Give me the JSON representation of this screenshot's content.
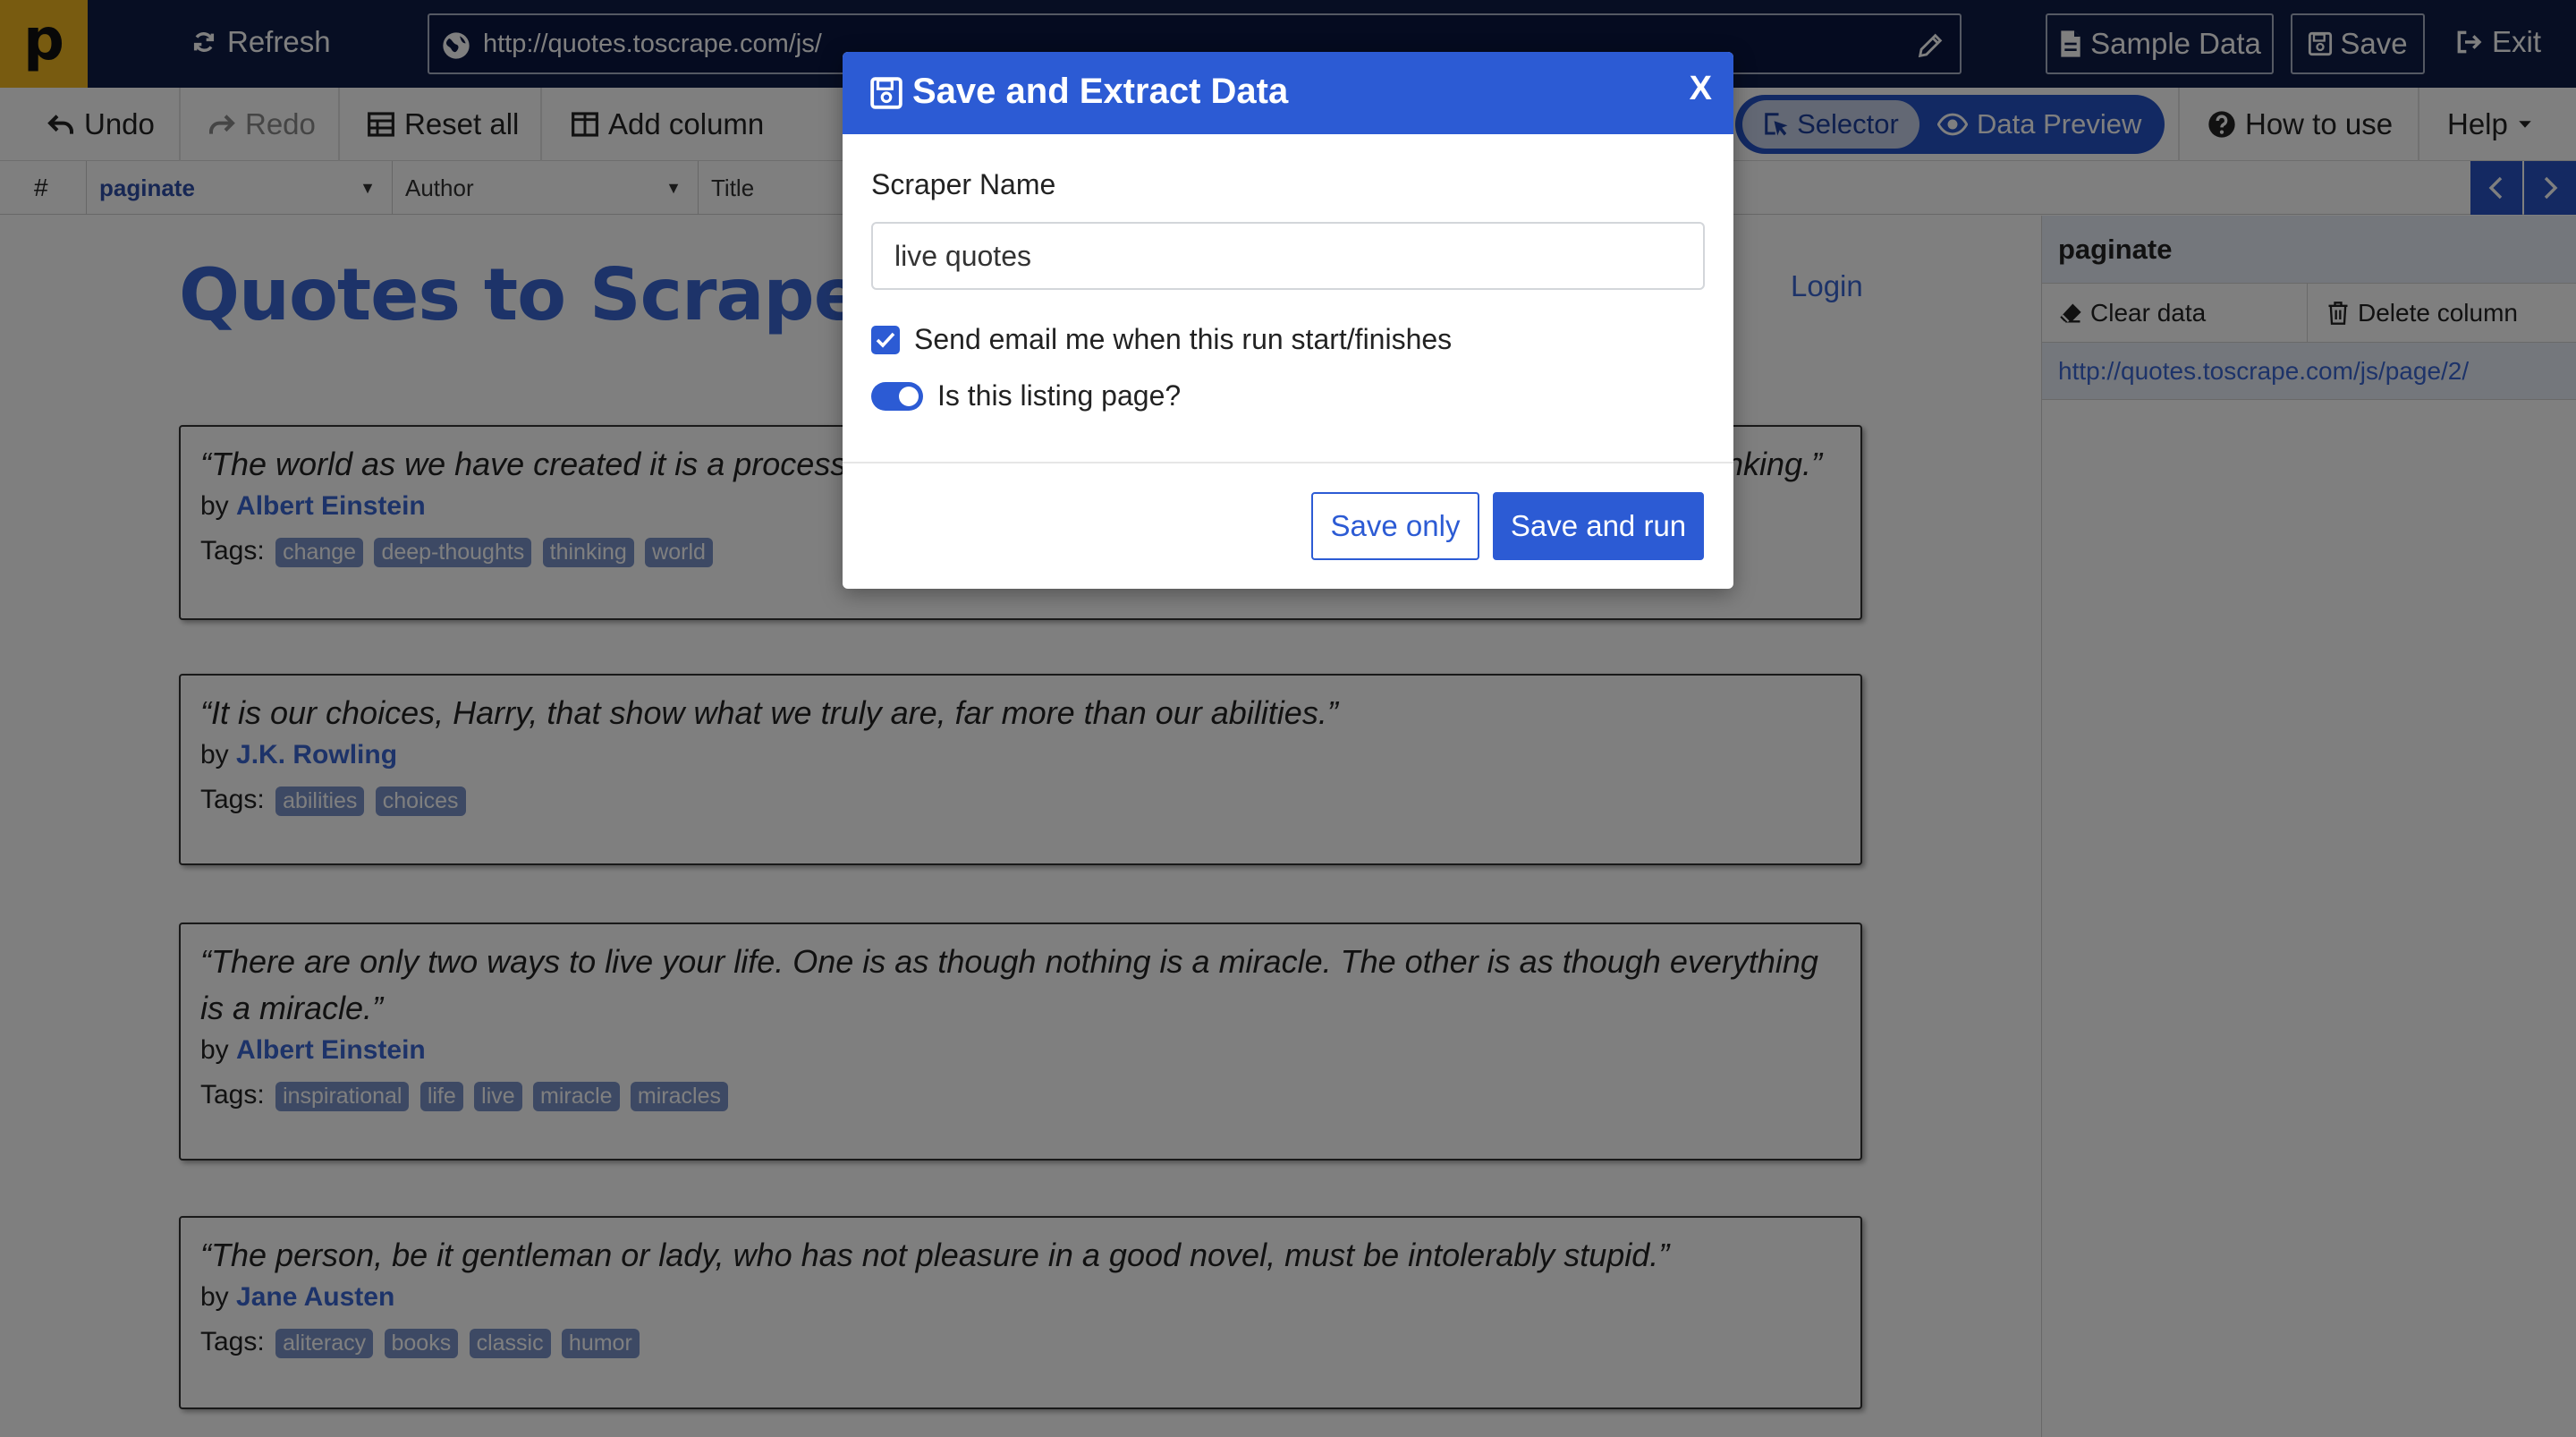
{
  "app": {
    "logo_letter": "p",
    "refresh_label": "Refresh",
    "url": "http://quotes.toscrape.com/js/",
    "sample_data_label": "Sample Data",
    "save_label": "Save",
    "exit_label": "Exit"
  },
  "toolbar": {
    "undo_label": "Undo",
    "redo_label": "Redo",
    "reset_all_label": "Reset all",
    "add_column_label": "Add column",
    "selector_label": "Selector",
    "data_preview_label": "Data Preview",
    "how_to_use_label": "How to use",
    "help_label": "Help"
  },
  "columns": {
    "hash": "#",
    "items": [
      "paginate",
      "Author",
      "Title"
    ]
  },
  "page": {
    "site_title": "Quotes to Scrape",
    "login_label": "Login",
    "by_label": "by",
    "tags_label": "Tags:",
    "quotes": [
      {
        "text": "“The world as we have created it is a process of our thinking. It cannot be changed without changing our thinking.”",
        "author": "Albert Einstein",
        "tags": [
          "change",
          "deep-thoughts",
          "thinking",
          "world"
        ]
      },
      {
        "text": "“It is our choices, Harry, that show what we truly are, far more than our abilities.”",
        "author": "J.K. Rowling",
        "tags": [
          "abilities",
          "choices"
        ]
      },
      {
        "text": "“There are only two ways to live your life. One is as though nothing is a miracle. The other is as though everything is a miracle.”",
        "author": "Albert Einstein",
        "tags": [
          "inspirational",
          "life",
          "live",
          "miracle",
          "miracles"
        ]
      },
      {
        "text": "“The person, be it gentleman or lady, who has not pleasure in a good novel, must be intolerably stupid.”",
        "author": "Jane Austen",
        "tags": [
          "aliteracy",
          "books",
          "classic",
          "humor"
        ]
      }
    ]
  },
  "sidebar": {
    "title": "paginate",
    "clear_data_label": "Clear data",
    "delete_column_label": "Delete column",
    "rows": [
      "http://quotes.toscrape.com/js/page/2/"
    ]
  },
  "modal": {
    "title": "Save and Extract Data",
    "close_label": "X",
    "scraper_name_label": "Scraper Name",
    "scraper_name_value": "live quotes",
    "email_label": "Send email me when this run start/finishes",
    "email_checked": true,
    "listing_label": "Is this listing page?",
    "listing_on": true,
    "save_only_label": "Save only",
    "save_and_run_label": "Save and run"
  },
  "colors": {
    "topbar_bg": "#0f1d47",
    "logo_bg": "#f1b620",
    "accent": "#2c5bd4",
    "link": "#3a66d3",
    "tag_bg": "#7b93c9"
  }
}
